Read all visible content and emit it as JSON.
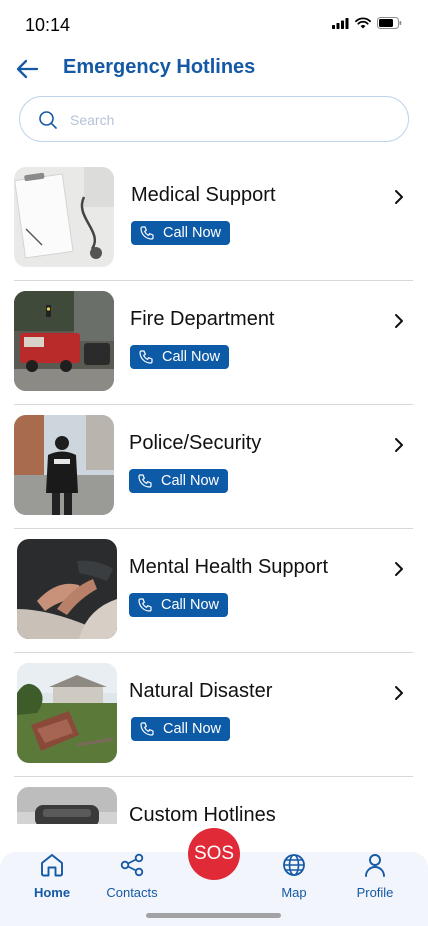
{
  "status_bar": {
    "time": "10:14"
  },
  "header": {
    "title": "Emergency Hotlines"
  },
  "search": {
    "placeholder": "Search"
  },
  "hotlines": [
    {
      "name": "Medical Support",
      "call_label": "Call Now"
    },
    {
      "name": "Fire Department",
      "call_label": "Call Now"
    },
    {
      "name": "Police/Security",
      "call_label": "Call Now"
    },
    {
      "name": "Mental Health Support",
      "call_label": "Call Now"
    },
    {
      "name": "Natural Disaster",
      "call_label": "Call Now"
    },
    {
      "name": "Custom Hotlines"
    }
  ],
  "tabbar": {
    "home": "Home",
    "contacts": "Contacts",
    "sos": "SOS",
    "map": "Map",
    "profile": "Profile",
    "active_tab": "home"
  },
  "colors": {
    "primary": "#1559a6",
    "call_button": "#0d5aa6",
    "sos": "#e12a38",
    "tabbar_bg": "#f2f5fb"
  }
}
